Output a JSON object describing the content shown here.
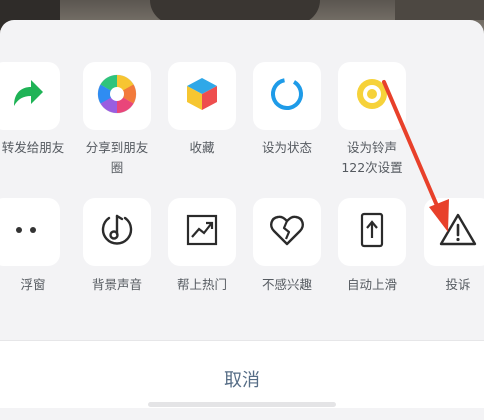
{
  "share_sheet": {
    "row1": [
      {
        "label": "转发给朋友",
        "icon": "forward-arrow-icon",
        "color": "#1fb356"
      },
      {
        "label": "分享到朋友\n圈",
        "icon": "moments-aperture-icon"
      },
      {
        "label": "收藏",
        "icon": "favorite-cube-icon"
      },
      {
        "label": "设为状态",
        "icon": "status-ring-icon",
        "color": "#1e9be8"
      },
      {
        "label": "设为铃声\n122次设置",
        "icon": "ringtone-icon",
        "color": "#f1c40f"
      }
    ],
    "row2": [
      {
        "label": "浮窗",
        "icon": "floating-window-icon"
      },
      {
        "label": "背景声音",
        "icon": "background-music-icon"
      },
      {
        "label": "帮上热门",
        "icon": "trending-chart-icon"
      },
      {
        "label": "不感兴趣",
        "icon": "broken-heart-icon"
      },
      {
        "label": "自动上滑",
        "icon": "auto-scroll-up-icon"
      },
      {
        "label": "投诉",
        "icon": "warning-triangle-icon"
      }
    ]
  },
  "cancel_label": "取消",
  "annotation": {
    "arrow_color": "#e8402a"
  }
}
